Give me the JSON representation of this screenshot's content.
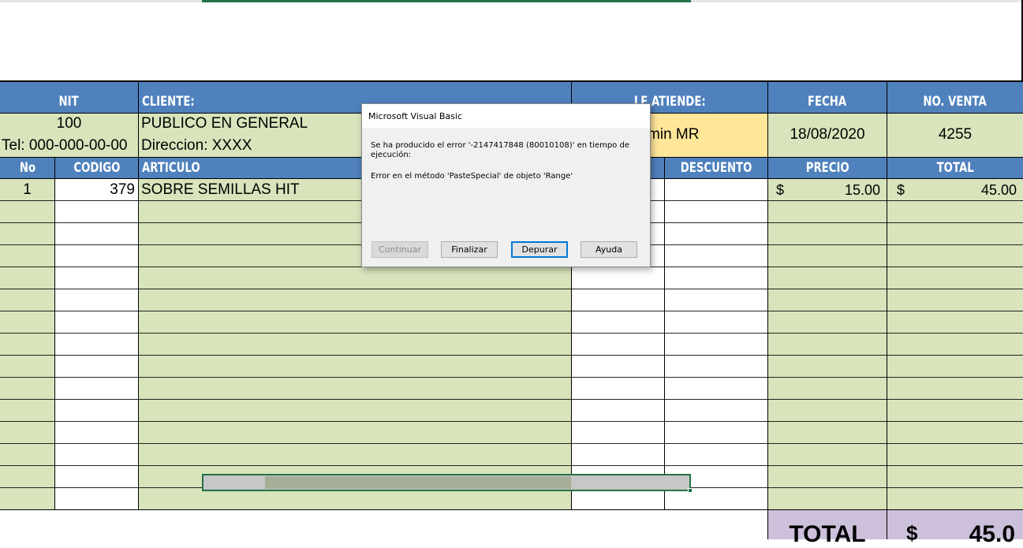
{
  "header": {
    "nit_label": "NIT",
    "cliente_label": "CLIENTE:",
    "atiende_label": "LE ATIENDE:",
    "fecha_label": "FECHA",
    "venta_label": "NO. VENTA"
  },
  "customer": {
    "nit": "100",
    "name": "PUBLICO EN GENERAL",
    "tel": "Tel: 000-000-00-00",
    "direccion": "Direccion: XXXX",
    "atiende_value": "zmin MR",
    "fecha": "18/08/2020",
    "no_venta": "4255"
  },
  "table": {
    "col_no": "No",
    "col_codigo": "CODIGO",
    "col_articulo": "ARTICULO",
    "col_descuento": "DESCUENTO",
    "col_precio": "PRECIO",
    "col_total": "TOTAL",
    "rows": [
      {
        "no": "1",
        "codigo": "379",
        "articulo": "SOBRE SEMILLAS HIT",
        "precio_sym": "$",
        "precio": "15.00",
        "total_sym": "$",
        "total": "45.00"
      }
    ]
  },
  "footer": {
    "total_label": "TOTAL",
    "total_sym": "$",
    "total_value": "45.0"
  },
  "dialog": {
    "title": "Microsoft Visual Basic",
    "message_line1": "Se ha producido el error '-2147417848 (80010108)' en tiempo de ejecución:",
    "message_line2": "Error en el método 'PasteSpecial' de objeto 'Range'",
    "btn_continuar": "Continuar",
    "btn_finalizar": "Finalizar",
    "btn_depurar": "Depurar",
    "btn_ayuda": "Ayuda"
  },
  "colors": {
    "header_blue": "#4f81bd",
    "cell_green": "#d8e4bc",
    "cell_yellow": "#ffe699",
    "total_lilac": "#ccc0da",
    "selection_green": "#217346"
  }
}
